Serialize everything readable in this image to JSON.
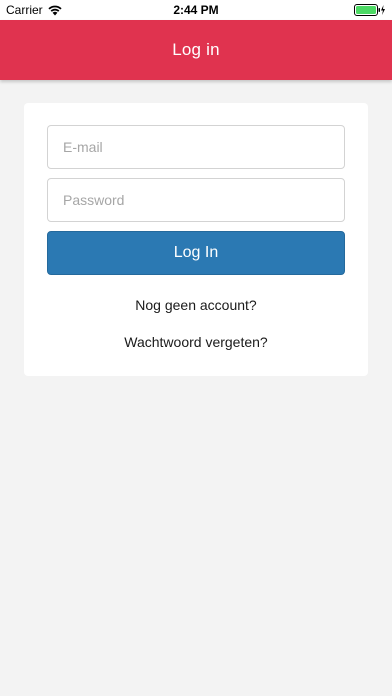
{
  "status_bar": {
    "carrier": "Carrier",
    "time": "2:44 PM",
    "icons": [
      "wifi-icon",
      "battery-charging-icon"
    ]
  },
  "header": {
    "title": "Log in",
    "color": "#e0334f"
  },
  "form": {
    "email": {
      "placeholder": "E-mail",
      "value": ""
    },
    "password": {
      "placeholder": "Password",
      "value": ""
    },
    "submit_label": "Log In",
    "submit_color": "#2b79b3",
    "signup_link": "Nog geen account?",
    "forgot_link": "Wachtwoord vergeten?"
  }
}
